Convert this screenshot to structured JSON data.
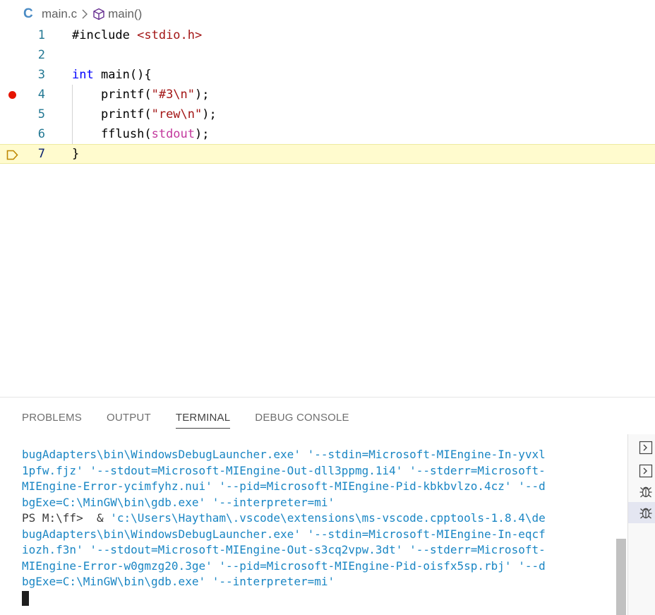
{
  "breadcrumb": {
    "language_badge": "C",
    "file": "main.c",
    "symbol": "main()"
  },
  "editor": {
    "lines": [
      {
        "number": "1",
        "tokens": [
          [
            "plain",
            "#include "
          ],
          [
            "str",
            "<stdio.h>"
          ]
        ]
      },
      {
        "number": "2",
        "tokens": []
      },
      {
        "number": "3",
        "tokens": [
          [
            "kw",
            "int"
          ],
          [
            "plain",
            " main(){"
          ]
        ]
      },
      {
        "number": "4",
        "tokens": [
          [
            "plain",
            "    printf("
          ],
          [
            "str",
            "\"#3\\n\""
          ],
          [
            "plain",
            ");"
          ]
        ],
        "breakpoint": true
      },
      {
        "number": "5",
        "tokens": [
          [
            "plain",
            "    printf("
          ],
          [
            "str",
            "\"rew\\n\""
          ],
          [
            "plain",
            ");"
          ]
        ]
      },
      {
        "number": "6",
        "tokens": [
          [
            "plain",
            "    fflush("
          ],
          [
            "var",
            "stdout"
          ],
          [
            "plain",
            ");"
          ]
        ]
      },
      {
        "number": "7",
        "tokens": [
          [
            "plain",
            "}"
          ]
        ],
        "current": true
      }
    ]
  },
  "panel": {
    "tabs": [
      "PROBLEMS",
      "OUTPUT",
      "TERMINAL",
      "DEBUG CONSOLE"
    ],
    "active_tab": "TERMINAL"
  },
  "terminal": {
    "lines": [
      {
        "text": "bugAdapters\\bin\\WindowsDebugLauncher.exe' '--stdin=Microsoft-MIEngine-In-yvxl",
        "style": "blue"
      },
      {
        "text": "1pfw.fjz' '--stdout=Microsoft-MIEngine-Out-dll3ppmg.1i4' '--stderr=Microsoft-",
        "style": "blue"
      },
      {
        "text": "MIEngine-Error-ycimfyhz.nui' '--pid=Microsoft-MIEngine-Pid-kbkbvlzo.4cz' '--d",
        "style": "blue"
      },
      {
        "text": "bgExe=C:\\MinGW\\bin\\gdb.exe' '--interpreter=mi'",
        "style": "blue"
      },
      {
        "prompt": "PS M:\\ff>  & ",
        "text": "'c:\\Users\\Haytham\\.vscode\\extensions\\ms-vscode.cpptools-1.8.4\\de",
        "style": "prompt"
      },
      {
        "text": "bugAdapters\\bin\\WindowsDebugLauncher.exe' '--stdin=Microsoft-MIEngine-In-eqcf",
        "style": "blue"
      },
      {
        "text": "iozh.f3n' '--stdout=Microsoft-MIEngine-Out-s3cq2vpw.3dt' '--stderr=Microsoft-",
        "style": "blue"
      },
      {
        "text": "MIEngine-Error-w0gmzg20.3ge' '--pid=Microsoft-MIEngine-Pid-oisfx5sp.rbj' '--d",
        "style": "blue"
      },
      {
        "text": "bgExe=C:\\MinGW\\bin\\gdb.exe' '--interpreter=mi'",
        "style": "blue"
      }
    ]
  },
  "side_panel": {
    "items": [
      {
        "icon": "terminal-icon"
      },
      {
        "icon": "terminal-icon"
      },
      {
        "icon": "debug-icon"
      },
      {
        "icon": "debug-icon",
        "selected": true
      }
    ]
  },
  "colors": {
    "breakpoint": "#e51400",
    "current_line": "#fffbce",
    "terminal_text": "#1a86c4"
  }
}
